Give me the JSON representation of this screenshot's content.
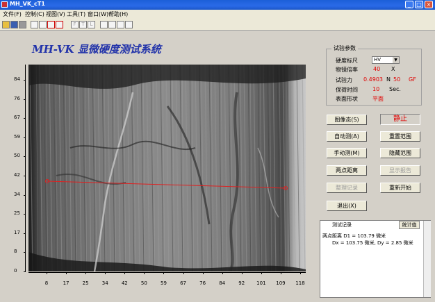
{
  "window": {
    "title": "MH_VK_cT1"
  },
  "menu": [
    "文件(F)",
    "控制(C)",
    "视图(V)",
    "工具(T)",
    "窗口(W)",
    "帮助(H)"
  ],
  "toolbar": {
    "letters": [
      "F",
      "T",
      "L"
    ]
  },
  "app_title": "MH-VK 显微硬度测试系统",
  "axis": {
    "y_ticks": [
      "84",
      "76",
      "67",
      "59",
      "50",
      "42",
      "34",
      "25",
      "17",
      "8",
      "0"
    ],
    "x_ticks": [
      "8",
      "17",
      "25",
      "34",
      "42",
      "50",
      "59",
      "67",
      "76",
      "84",
      "92",
      "101",
      "109",
      "118"
    ]
  },
  "params": {
    "title": "试验参数",
    "hardness_label": "硬度标尺",
    "hardness_value": "HV",
    "mag_label": "物镜倍率",
    "mag_value": "40",
    "mag_unit": "X",
    "force_label": "试验力",
    "force_value": "0.4903",
    "force_unit": "N",
    "force_gf": "50",
    "force_gf_unit": "GF",
    "dwell_label": "保荷时间",
    "dwell_value": "10",
    "dwell_unit": "Sec.",
    "shape_label": "表面形状",
    "shape_value": "平面"
  },
  "buttons": {
    "image_state": "图像态(S)",
    "status": "静止",
    "auto_measure": "自动测(A)",
    "reset_range": "重置范围",
    "manual_measure": "手动测(M)",
    "hide_range": "隐藏范围",
    "two_point": "两点距离",
    "show_report": "显示报告",
    "edit_record": "整理记录",
    "restart": "重新开始",
    "exit": "退出(X)"
  },
  "record": {
    "title": "测试记录",
    "stats_button": "统计值",
    "line1": "两点距离 D1 = 103.79 微米",
    "line2": "Dx = 103.75 微米, Dy = 2.85 微米"
  }
}
